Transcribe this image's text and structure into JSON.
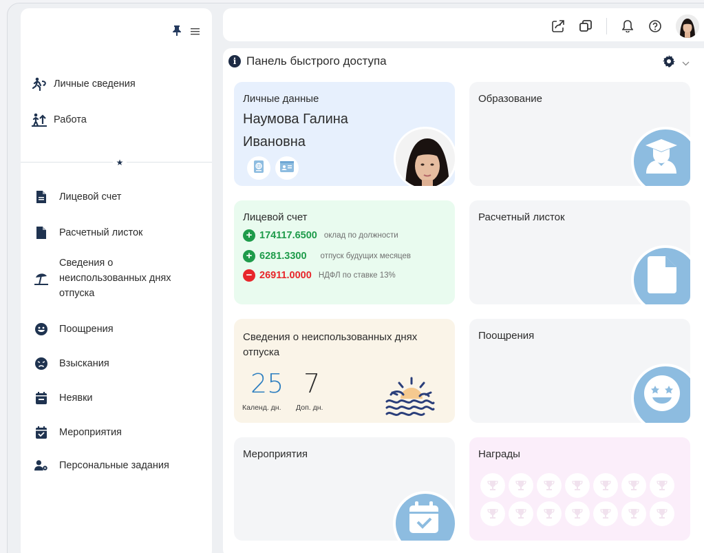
{
  "sidebar": {
    "top_items": [
      {
        "label": "Личные сведения",
        "icon": "person-running-icon"
      },
      {
        "label": "Работа",
        "icon": "person-arrow-up-icon"
      }
    ],
    "links": [
      {
        "label": "Лицевой счет",
        "icon": "file-lines-icon"
      },
      {
        "label": "Расчетный листок",
        "icon": "file-icon"
      },
      {
        "label_lines": [
          "Сведения о",
          "неиспользованных днях",
          "отпуска"
        ],
        "icon": "umbrella-beach-icon"
      },
      {
        "label": "Поощрения",
        "icon": "grin-icon"
      },
      {
        "label": "Взыскания",
        "icon": "angry-face-icon"
      },
      {
        "label": "Неявки",
        "icon": "calendar-minus-icon"
      },
      {
        "label": "Мероприятия",
        "icon": "calendar-check-icon"
      },
      {
        "label": "Персональные задания",
        "icon": "user-gear-icon"
      }
    ]
  },
  "panel": {
    "title": "Панель быстрого доступа"
  },
  "cards": {
    "personal": {
      "title": "Личные данные",
      "name_line1": "Наумова Галина",
      "name_line2": "Ивановна"
    },
    "education": {
      "title": "Образование"
    },
    "account": {
      "title": "Лицевой счет",
      "rows": [
        {
          "sign": "+",
          "value": "174117.6500",
          "note": "оклад по должности",
          "color": "#1e9b4a"
        },
        {
          "sign": "+",
          "value": "6281.3300",
          "note": "отпуск будущих месяцев",
          "color": "#1e9b4a"
        },
        {
          "sign": "−",
          "value": "26911.0000",
          "note": "НДФЛ по ставке 13%",
          "color": "#e8262b"
        }
      ]
    },
    "payslip": {
      "title": "Расчетный листок"
    },
    "vacation": {
      "title_line1": "Сведения о неиспользованных днях",
      "title_line2": "отпуска",
      "calendar_days": "25",
      "calendar_label": "Календ. дн.",
      "extra_days": "7",
      "extra_label": "Доп. дн."
    },
    "encouragements": {
      "title": "Поощрения"
    },
    "events": {
      "title": "Мероприятия"
    },
    "awards": {
      "title": "Награды",
      "count": 14
    }
  },
  "colors": {
    "accent_blue": "#8dbce0",
    "positive": "#1e9b4a",
    "negative": "#e8262b",
    "vac_blue": "#2e7fc0"
  }
}
